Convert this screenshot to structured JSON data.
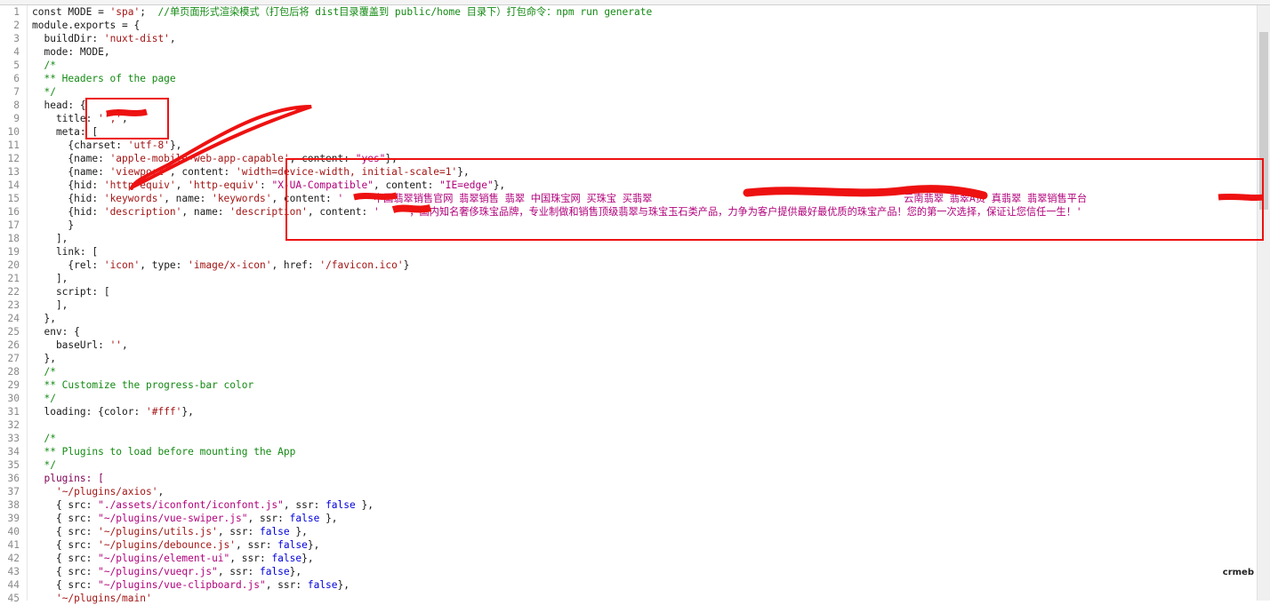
{
  "lines": [
    {
      "n": "1",
      "parts": [
        {
          "t": "const MODE = "
        },
        {
          "t": "'spa'",
          "c": "s"
        },
        {
          "t": ";  "
        },
        {
          "t": "//单页面形式渲染模式（打包后将 dist目录覆盖到 public/home 目录下）打包命令：npm run generate",
          "c": "c"
        }
      ]
    },
    {
      "n": "2",
      "parts": [
        {
          "t": "module.exports = {"
        }
      ]
    },
    {
      "n": "3",
      "parts": [
        {
          "t": "  buildDir: "
        },
        {
          "t": "'nuxt-dist'",
          "c": "s"
        },
        {
          "t": ","
        }
      ]
    },
    {
      "n": "4",
      "parts": [
        {
          "t": "  mode: MODE,"
        }
      ]
    },
    {
      "n": "5",
      "parts": [
        {
          "t": "  /*",
          "c": "c"
        }
      ]
    },
    {
      "n": "6",
      "parts": [
        {
          "t": "  ** Headers of the page",
          "c": "c"
        }
      ]
    },
    {
      "n": "7",
      "parts": [
        {
          "t": "  */",
          "c": "c"
        }
      ]
    },
    {
      "n": "8",
      "parts": [
        {
          "t": "  head: {"
        }
      ]
    },
    {
      "n": "9",
      "parts": [
        {
          "t": "    title: "
        },
        {
          "t": "'','",
          "c": "s"
        },
        {
          "t": ","
        }
      ]
    },
    {
      "n": "10",
      "parts": [
        {
          "t": "    meta: ["
        }
      ]
    },
    {
      "n": "11",
      "parts": [
        {
          "t": "      {charset: "
        },
        {
          "t": "'utf-8'",
          "c": "s"
        },
        {
          "t": "},"
        }
      ]
    },
    {
      "n": "12",
      "parts": [
        {
          "t": "      {name: "
        },
        {
          "t": "'apple-mobile-web-app-capable'",
          "c": "s"
        },
        {
          "t": ", content: "
        },
        {
          "t": "\"yes\"",
          "c": "str"
        },
        {
          "t": "},"
        }
      ]
    },
    {
      "n": "13",
      "parts": [
        {
          "t": "      {name: "
        },
        {
          "t": "'viewport'",
          "c": "s"
        },
        {
          "t": ", content: "
        },
        {
          "t": "'width=device-width, initial-scale=1'",
          "c": "s"
        },
        {
          "t": "},"
        }
      ]
    },
    {
      "n": "14",
      "parts": [
        {
          "t": "      {hid: "
        },
        {
          "t": "'http-equiv'",
          "c": "s"
        },
        {
          "t": ", "
        },
        {
          "t": "'http-equiv'",
          "c": "s"
        },
        {
          "t": ": "
        },
        {
          "t": "\"X-UA-Compatible\"",
          "c": "str"
        },
        {
          "t": ", content: "
        },
        {
          "t": "\"IE=edge\"",
          "c": "str"
        },
        {
          "t": "},"
        }
      ]
    },
    {
      "n": "15",
      "parts": [
        {
          "t": "      {hid: "
        },
        {
          "t": "'keywords'",
          "c": "s"
        },
        {
          "t": ", name: "
        },
        {
          "t": "'keywords'",
          "c": "s"
        },
        {
          "t": ", content: "
        },
        {
          "t": "'     中国翡翠销售官网 翡翠销售 翡翠 中国珠宝网 买珠宝 买翡翠                                          云南翡翠 翡翠A货 真翡翠 翡翠销售平台",
          "c": "str"
        }
      ]
    },
    {
      "n": "16",
      "parts": [
        {
          "t": "      {hid: "
        },
        {
          "t": "'description'",
          "c": "s"
        },
        {
          "t": ", name: "
        },
        {
          "t": "'description'",
          "c": "s"
        },
        {
          "t": ", content: "
        },
        {
          "t": "'     ，国内知名奢侈珠宝品牌，专业制做和销售顶级翡翠与珠宝玉石类产品，力争为客户提供最好最优质的珠宝产品！您的第一次选择，保证让您信任一生！'",
          "c": "str"
        }
      ]
    },
    {
      "n": "17",
      "parts": [
        {
          "t": "      }"
        }
      ]
    },
    {
      "n": "18",
      "parts": [
        {
          "t": "    ],"
        }
      ]
    },
    {
      "n": "19",
      "parts": [
        {
          "t": "    link: ["
        }
      ]
    },
    {
      "n": "20",
      "parts": [
        {
          "t": "      {rel: "
        },
        {
          "t": "'icon'",
          "c": "s"
        },
        {
          "t": ", type: "
        },
        {
          "t": "'image/x-icon'",
          "c": "s"
        },
        {
          "t": ", href: "
        },
        {
          "t": "'/favicon.ico'",
          "c": "s"
        },
        {
          "t": "}"
        }
      ]
    },
    {
      "n": "21",
      "parts": [
        {
          "t": "    ],"
        }
      ]
    },
    {
      "n": "22",
      "parts": [
        {
          "t": "    script: ["
        }
      ]
    },
    {
      "n": "23",
      "parts": [
        {
          "t": "    ],"
        }
      ]
    },
    {
      "n": "24",
      "parts": [
        {
          "t": "  },"
        }
      ]
    },
    {
      "n": "25",
      "parts": [
        {
          "t": "  env: {"
        }
      ]
    },
    {
      "n": "26",
      "parts": [
        {
          "t": "    baseUrl: "
        },
        {
          "t": "''",
          "c": "s"
        },
        {
          "t": ","
        }
      ]
    },
    {
      "n": "27",
      "parts": [
        {
          "t": "  },"
        }
      ]
    },
    {
      "n": "28",
      "parts": [
        {
          "t": "  /*",
          "c": "c"
        }
      ]
    },
    {
      "n": "29",
      "parts": [
        {
          "t": "  ** Customize the progress-bar color",
          "c": "c"
        }
      ]
    },
    {
      "n": "30",
      "parts": [
        {
          "t": "  */",
          "c": "c"
        }
      ]
    },
    {
      "n": "31",
      "parts": [
        {
          "t": "  loading: {color: "
        },
        {
          "t": "'#fff'",
          "c": "s"
        },
        {
          "t": "},"
        }
      ]
    },
    {
      "n": "32",
      "parts": [
        {
          "t": ""
        }
      ]
    },
    {
      "n": "33",
      "parts": [
        {
          "t": "  /*",
          "c": "c"
        }
      ]
    },
    {
      "n": "34",
      "parts": [
        {
          "t": "  ** Plugins to load before mounting the App",
          "c": "c"
        }
      ]
    },
    {
      "n": "35",
      "parts": [
        {
          "t": "  */",
          "c": "c"
        }
      ]
    },
    {
      "n": "36",
      "parts": [
        {
          "t": "  plugins: [",
          "c": "k"
        }
      ]
    },
    {
      "n": "37",
      "parts": [
        {
          "t": "    "
        },
        {
          "t": "'~/plugins/axios'",
          "c": "s"
        },
        {
          "t": ","
        }
      ]
    },
    {
      "n": "38",
      "parts": [
        {
          "t": "    { src: "
        },
        {
          "t": "\"./assets/iconfont/iconfont.js\"",
          "c": "str"
        },
        {
          "t": ", ssr: "
        },
        {
          "t": "false",
          "c": "b"
        },
        {
          "t": " },"
        }
      ]
    },
    {
      "n": "39",
      "parts": [
        {
          "t": "    { src: "
        },
        {
          "t": "\"~/plugins/vue-swiper.js\"",
          "c": "str"
        },
        {
          "t": ", ssr: "
        },
        {
          "t": "false",
          "c": "b"
        },
        {
          "t": " },"
        }
      ]
    },
    {
      "n": "40",
      "parts": [
        {
          "t": "    { src: "
        },
        {
          "t": "'~/plugins/utils.js'",
          "c": "s"
        },
        {
          "t": ", ssr: "
        },
        {
          "t": "false",
          "c": "b"
        },
        {
          "t": " },"
        }
      ]
    },
    {
      "n": "41",
      "parts": [
        {
          "t": "    { src: "
        },
        {
          "t": "'~/plugins/debounce.js'",
          "c": "s"
        },
        {
          "t": ", ssr: "
        },
        {
          "t": "false",
          "c": "b"
        },
        {
          "t": "},"
        }
      ]
    },
    {
      "n": "42",
      "parts": [
        {
          "t": "    { src: "
        },
        {
          "t": "\"~/plugins/element-ui\"",
          "c": "str"
        },
        {
          "t": ", ssr: "
        },
        {
          "t": "false",
          "c": "b"
        },
        {
          "t": "},"
        }
      ]
    },
    {
      "n": "43",
      "parts": [
        {
          "t": "    { src: "
        },
        {
          "t": "\"~/plugins/vueqr.js\"",
          "c": "str"
        },
        {
          "t": ", ssr: "
        },
        {
          "t": "false",
          "c": "b"
        },
        {
          "t": "},"
        }
      ]
    },
    {
      "n": "44",
      "parts": [
        {
          "t": "    { src: "
        },
        {
          "t": "\"~/plugins/vue-clipboard.js\"",
          "c": "str"
        },
        {
          "t": ", ssr: "
        },
        {
          "t": "false",
          "c": "b"
        },
        {
          "t": "},"
        }
      ]
    },
    {
      "n": "45",
      "parts": [
        {
          "t": "    "
        },
        {
          "t": "'~/plugins/main'",
          "c": "s"
        }
      ]
    }
  ],
  "watermark": "crmeb",
  "colors": {
    "annotation_red": "#ee1111",
    "string": "#a31515",
    "string_cjk": "#b0007a",
    "comment": "#138a13",
    "keyword_blue": "#0000dd"
  }
}
